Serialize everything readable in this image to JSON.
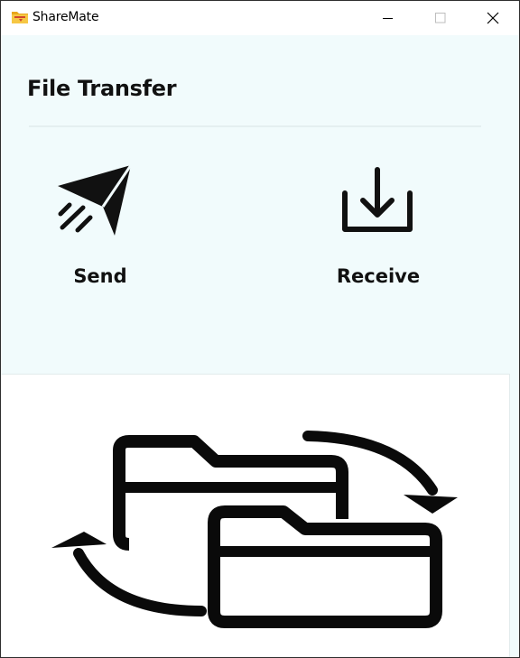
{
  "window": {
    "title": "ShareMate",
    "app_icon": "folder-icon",
    "controls": {
      "minimize": "minimize-icon",
      "maximize": "maximize-icon",
      "close": "close-icon"
    }
  },
  "main": {
    "title": "File Transfer",
    "actions": [
      {
        "label": "Send",
        "icon": "paper-plane-icon"
      },
      {
        "label": "Receive",
        "icon": "download-tray-icon"
      }
    ],
    "illustration": {
      "icon": "folders-transfer-icon"
    }
  },
  "colors": {
    "background": "#f1fbfc",
    "panel": "#ffffff",
    "text": "#111111",
    "app_icon": "#f2b21b"
  }
}
